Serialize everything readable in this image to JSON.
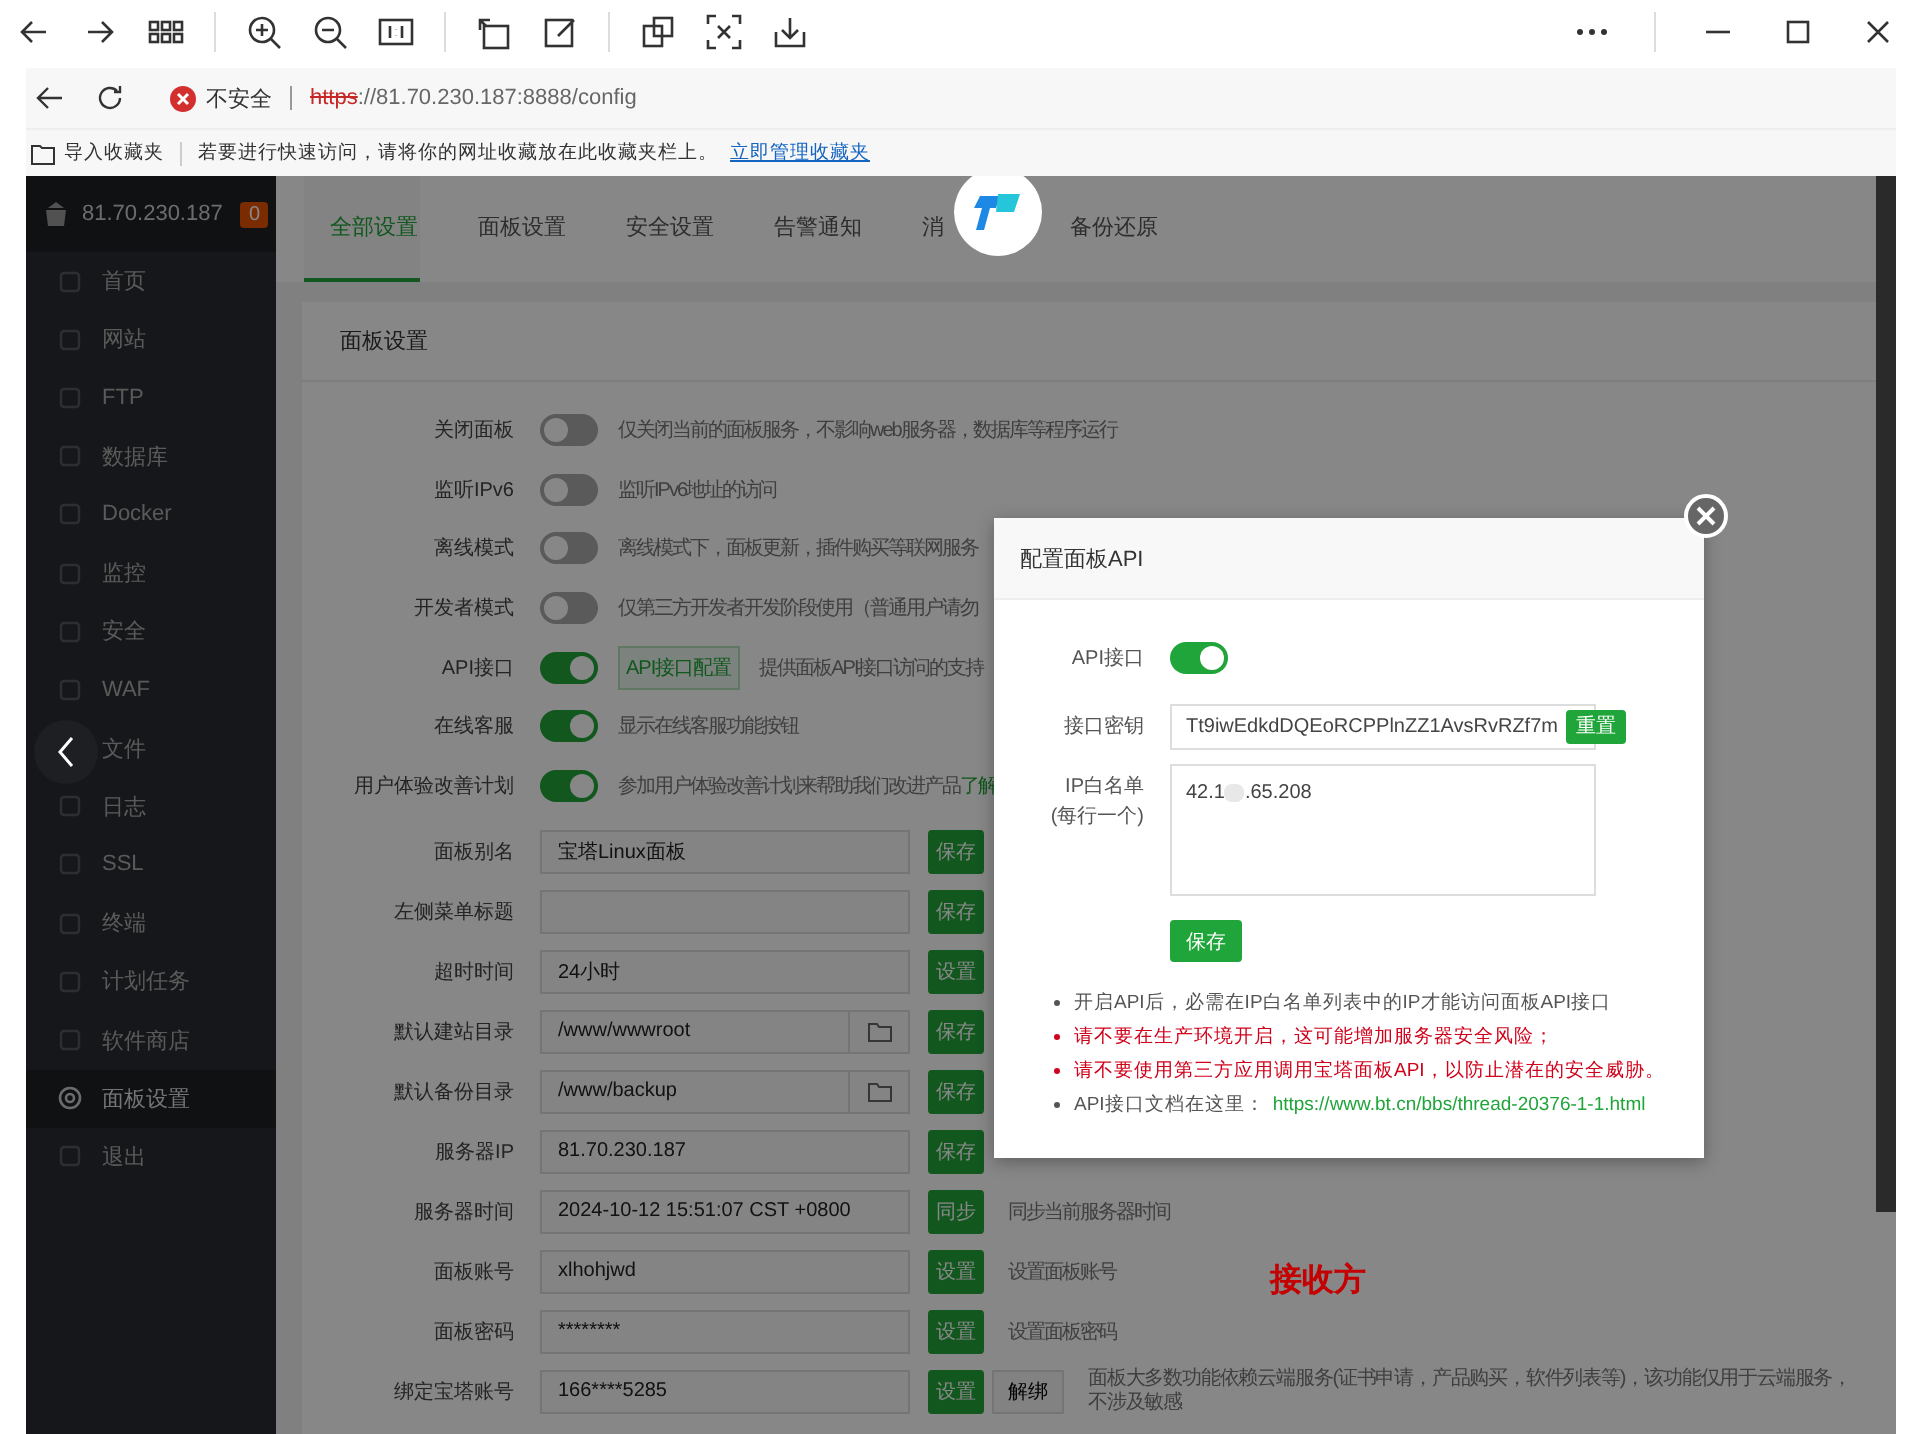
{
  "browser": {
    "address": {
      "security": "不安全",
      "scheme": "https",
      "rest": "://81.70.230.187:8888/config"
    },
    "favorites": {
      "import": "导入收藏夹",
      "message": "若要进行快速访问，请将你的网址收藏放在此收藏夹栏上。",
      "link": "立即管理收藏夹"
    }
  },
  "sidebar": {
    "host": "81.70.230.187",
    "badge": "0",
    "items": [
      {
        "label": "首页",
        "selected": false
      },
      {
        "label": "网站",
        "selected": false
      },
      {
        "label": "FTP",
        "selected": false
      },
      {
        "label": "数据库",
        "selected": false
      },
      {
        "label": "Docker",
        "selected": false
      },
      {
        "label": "监控",
        "selected": false
      },
      {
        "label": "安全",
        "selected": false
      },
      {
        "label": "WAF",
        "selected": false
      },
      {
        "label": "文件",
        "selected": false
      },
      {
        "label": "日志",
        "selected": false
      },
      {
        "label": "SSL",
        "selected": false
      },
      {
        "label": "终端",
        "selected": false
      },
      {
        "label": "计划任务",
        "selected": false
      },
      {
        "label": "软件商店",
        "selected": false
      },
      {
        "label": "面板设置",
        "selected": true
      },
      {
        "label": "退出",
        "selected": false
      }
    ]
  },
  "tabs": [
    {
      "label": "全部设置",
      "selected": true
    },
    {
      "label": "面板设置",
      "selected": false
    },
    {
      "label": "安全设置",
      "selected": false
    },
    {
      "label": "告警通知",
      "selected": false
    },
    {
      "label": "消",
      "selected": false
    },
    {
      "label": "备份还原",
      "selected": false
    }
  ],
  "section_title": "面板设置",
  "settings": [
    {
      "kind": "toggle",
      "label": "关闭面板",
      "on": false,
      "description": "仅关闭当前的面板服务，不影响web服务器，数据库等程序运行"
    },
    {
      "kind": "toggle",
      "label": "监听IPv6",
      "on": false,
      "description": "监听IPv6地址的访问"
    },
    {
      "kind": "toggle",
      "label": "离线模式",
      "on": false,
      "description": "离线模式下，面板更新，插件购买等联网服务"
    },
    {
      "kind": "toggle",
      "label": "开发者模式",
      "on": false,
      "description": "仅第三方开发者开发阶段使用（普通用户请勿"
    },
    {
      "kind": "toggle",
      "label": "API接口",
      "on": true,
      "button": "API接口配置",
      "description": "提供面板API接口访问的支持"
    },
    {
      "kind": "toggle",
      "label": "在线客服",
      "on": true,
      "description": "显示在线客服功能按钮"
    },
    {
      "kind": "toggle",
      "label": "用户体验改善计划",
      "on": true,
      "description": "参加用户体验改善计划来帮助我们改进产品",
      "link": "了解"
    },
    {
      "kind": "input",
      "label": "面板别名",
      "value": "宝塔Linux面板",
      "action": "保存"
    },
    {
      "kind": "input",
      "label": "左侧菜单标题",
      "action": "保存"
    },
    {
      "kind": "input",
      "label": "超时时间",
      "value": "24小时",
      "action": "设置"
    },
    {
      "kind": "folder",
      "label": "默认建站目录",
      "value": "/www/wwwroot",
      "action": "保存"
    },
    {
      "kind": "folder",
      "label": "默认备份目录",
      "value": "/www/backup",
      "action": "保存"
    },
    {
      "kind": "input",
      "label": "服务器IP",
      "value": "81.70.230.187",
      "action": "保存"
    },
    {
      "kind": "input",
      "label": "服务器时间",
      "value": "2024-10-12 15:51:07 CST +0800",
      "action": "同步",
      "description": "同步当前服务器时间"
    },
    {
      "kind": "input",
      "label": "面板账号",
      "value": "xlhohjwd",
      "action": "设置",
      "description": "设置面板账号"
    },
    {
      "kind": "input",
      "label": "面板密码",
      "value": "********",
      "action": "设置",
      "description": "设置面板密码"
    },
    {
      "kind": "input",
      "label": "绑定宝塔账号",
      "value": "166****5285",
      "action": "设置",
      "button": "解绑",
      "description": "面板大多数功能依赖云端服务(证书申请，产品购买，软件列表等)，该功能仅用于云端服务，不涉及敏感"
    }
  ],
  "annotation": "接收方",
  "modal": {
    "title": "配置面板API",
    "api": {
      "label": "API接口",
      "on": true
    },
    "key": {
      "label": "接口密钥",
      "value": "Tt9iwEdkdDQEoRCPPlnZZ1AvsRvRZf7m",
      "button": "重置"
    },
    "whitelist": {
      "label": "IP白名单",
      "sublabel": "(每行一个)",
      "value_start": "42.1",
      "value_end": ".65.208"
    },
    "save": "保存",
    "notes": [
      {
        "kind": "normal",
        "text": "开启API后，必需在IP白名单列表中的IP才能访问面板API接口"
      },
      {
        "kind": "warning",
        "text": "请不要在生产环境开启，这可能增加服务器安全风险；"
      },
      {
        "kind": "warning",
        "text": "请不要使用第三方应用调用宝塔面板API，以防止潜在的安全威胁。"
      },
      {
        "kind": "normal",
        "text": "API接口文档在这里：",
        "link": "https://www.bt.cn/bbs/thread-20376-1-1.html"
      }
    ]
  }
}
